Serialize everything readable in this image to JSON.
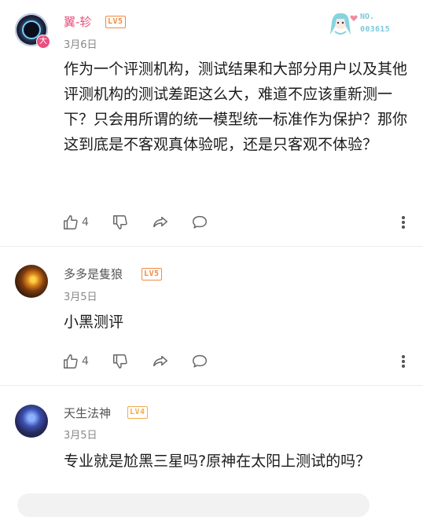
{
  "comments": [
    {
      "username": "翼-轸",
      "level": "LV5",
      "avatar_badge": "大",
      "date": "3月6日",
      "medal": {
        "no_label": "NO.",
        "number": "003615"
      },
      "text": "作为一个评测机构，测试结果和大部分用户以及其他评测机构的测试差距这么大，难道不应该重新测一下？只会用所谓的统一模型统一标准作为保护？那你这到底是不客观真体验呢，还是只客观不体验？",
      "likes": "4"
    },
    {
      "username": "多多是隻狼",
      "level": "LV5",
      "date": "3月5日",
      "text": "小黑测评",
      "likes": "4"
    },
    {
      "username": "天生法神",
      "level": "LV4",
      "date": "3月5日",
      "text": "专业就是尬黑三星吗?原神在太阳上测试的吗？"
    }
  ],
  "icons": {
    "like": "thumbs-up-icon",
    "dislike": "thumbs-down-icon",
    "share": "share-icon",
    "reply": "comment-icon",
    "more": "more-vertical-icon"
  },
  "colors": {
    "username_vip": "#e9507e",
    "level_badge": "#f28a3f",
    "medal": "#7ec8dc"
  }
}
